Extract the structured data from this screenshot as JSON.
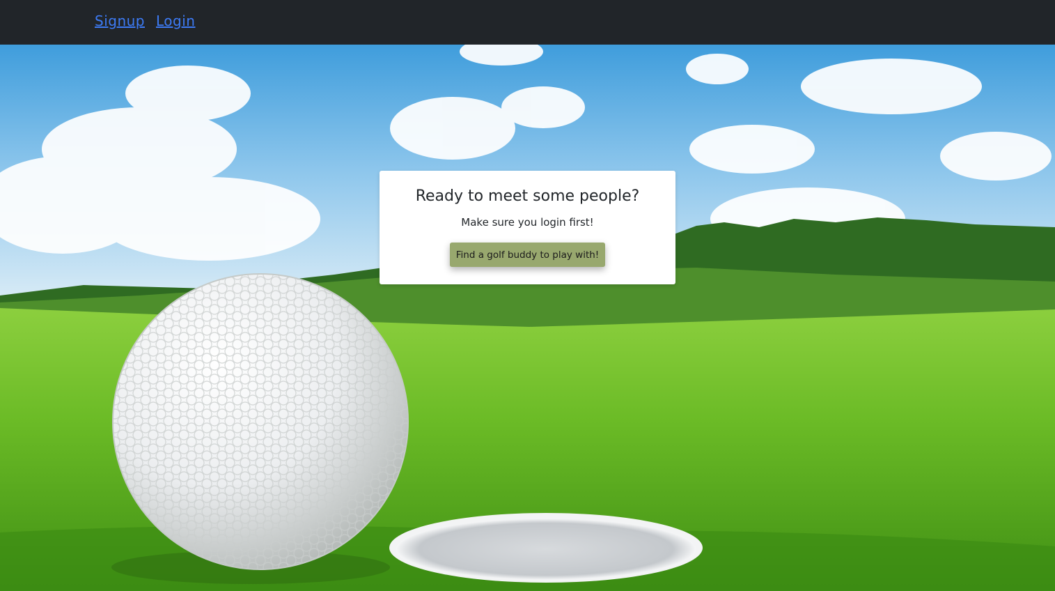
{
  "nav": {
    "links": [
      {
        "label": "Signup"
      },
      {
        "label": "Login"
      }
    ],
    "link_color": "#3d7bf5",
    "background": "#212529"
  },
  "card": {
    "title": "Ready to meet some people?",
    "subtitle": "Make sure you login first!",
    "button_label": "Find a golf buddy to play with!",
    "button_color": "#98a86e"
  },
  "hero": {
    "background_image": "golf ball beside hole on green fairway under blue sky"
  }
}
